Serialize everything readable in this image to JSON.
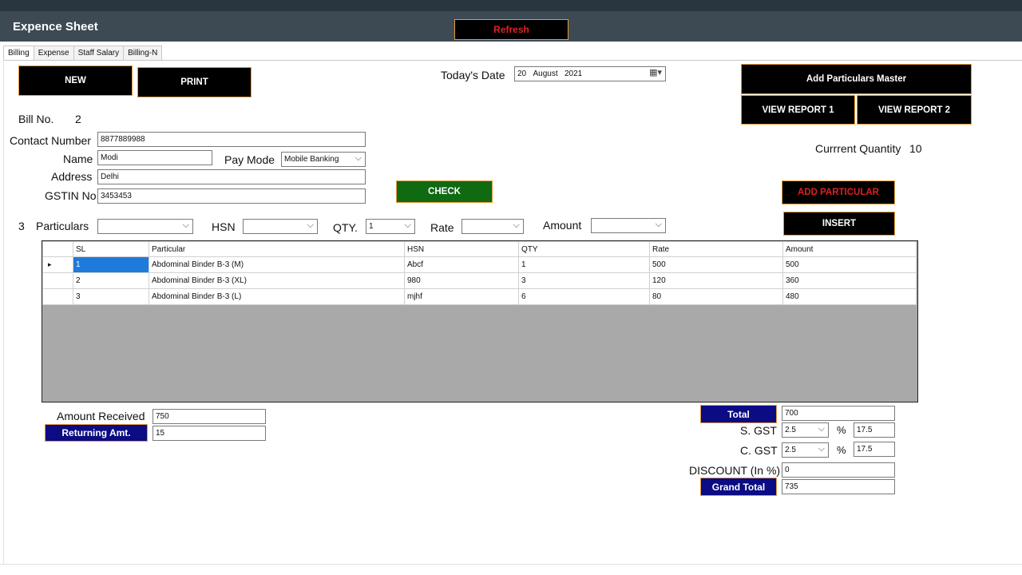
{
  "app": {
    "title": "Expence Sheet",
    "refresh_label": "Refresh"
  },
  "tabs": [
    {
      "label": "Billing",
      "active": true
    },
    {
      "label": "Expense",
      "active": false
    },
    {
      "label": "Staff Salary",
      "active": false
    },
    {
      "label": "Billing-N",
      "active": false
    }
  ],
  "buttons": {
    "new": "NEW",
    "print": "PRINT",
    "add_master": "Add Particulars Master",
    "view_report_1": "VIEW REPORT 1",
    "view_report_2": "VIEW REPORT 2",
    "check": "CHECK",
    "add_particular": "ADD PARTICULAR",
    "insert": "INSERT"
  },
  "date": {
    "label": "Today's Date",
    "day": "20",
    "month": "August",
    "year": "2021"
  },
  "bill": {
    "label": "Bill No.",
    "value": "2"
  },
  "quantity": {
    "label": "Currrent Quantity",
    "value": "10"
  },
  "form": {
    "contact_label": "Contact Number",
    "contact": "8877889988",
    "name_label": "Name",
    "name": "Modi",
    "paymode_label": "Pay Mode",
    "paymode": "Mobile Banking",
    "address_label": "Address",
    "address": "Delhi",
    "gstin_label": "GSTIN No",
    "gstin": "3453453"
  },
  "entry": {
    "count": "3",
    "particulars_label": "Particulars",
    "particulars": "",
    "hsn_label": "HSN",
    "hsn": "",
    "qty_label": "QTY.",
    "qty": "1",
    "rate_label": "Rate",
    "rate": "",
    "amount_label": "Amount",
    "amount": ""
  },
  "table": {
    "headers": [
      "SL",
      "Particular",
      "HSN",
      "QTY",
      "Rate",
      "Amount"
    ],
    "rows": [
      [
        "1",
        "Abdominal Binder B-3 (M)",
        "Abcf",
        "1",
        "500",
        "500"
      ],
      [
        "2",
        "Abdominal Binder B-3 (XL)",
        "980",
        "3",
        "120",
        "360"
      ],
      [
        "3",
        "Abdominal Binder B-3 (L)",
        "mjhf",
        "6",
        "80",
        "480"
      ]
    ],
    "current_row_marker": "▸"
  },
  "summary": {
    "amount_received_label": "Amount Received",
    "amount_received": "750",
    "returning_label": "Returning Amt.",
    "returning": "15",
    "total_label": "Total",
    "total": "700",
    "sgst_label": "S. GST",
    "sgst_rate": "2.5",
    "sgst_value": "17.5",
    "cgst_label": "C. GST",
    "cgst_rate": "2.5",
    "cgst_value": "17.5",
    "percent_sign": "%",
    "discount_label": "DISCOUNT (In %)",
    "discount": "0",
    "grand_total_label": "Grand Total",
    "grand_total": "735"
  }
}
